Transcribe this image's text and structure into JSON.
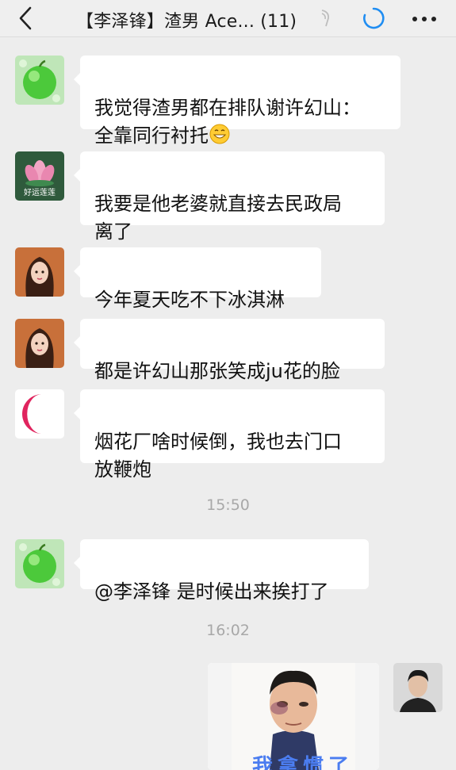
{
  "header": {
    "title": "【李泽锋】渣男 Ace... (11)",
    "mute_icon": "mute-icon",
    "loading_icon": "loading-icon",
    "more_icon": "more-icon"
  },
  "messages": [
    {
      "text": "我觉得渣男都在排队谢许幻山：\n全靠同行衬托",
      "emoji": "grinning-face-emoji",
      "avatar": "green-apple"
    },
    {
      "text": "我要是他老婆就直接去民政局\n离了",
      "avatar": "lotus"
    },
    {
      "text": "今年夏天吃不下冰淇淋",
      "avatar": "cartoon-girl"
    },
    {
      "text": "都是许幻山那张笑成ju花的脸",
      "avatar": "cartoon-girl"
    },
    {
      "text": "烟花厂啥时候倒，我也去门口\n放鞭炮",
      "avatar": "crescent-moon"
    },
    {
      "text": "@李泽锋 是时候出来挨打了",
      "avatar": "green-apple"
    }
  ],
  "lotus_avatar_caption": "好运莲莲",
  "timestamps": [
    "15:50",
    "16:02"
  ],
  "image_message": {
    "caption": "我拿惯了",
    "description": "bruised-man-photo"
  },
  "colors": {
    "background": "#ededed",
    "bubble": "#ffffff",
    "timestamp": "#a8a8a8",
    "accent": "#1f8df2"
  }
}
